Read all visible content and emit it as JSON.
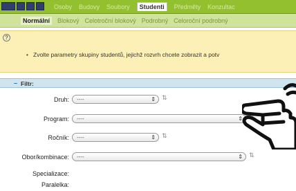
{
  "topbar": {
    "tabs": [
      "Osoby",
      "Budovy",
      "Soubory",
      "Studenti",
      "Předměty",
      "Konzultac"
    ],
    "active_tab": "Studenti"
  },
  "subbar": {
    "tabs": [
      "Normální",
      "Blokový",
      "Celotroční blokový",
      "Podrobný",
      "Celoroční podrobný"
    ],
    "active_tab": "Normální"
  },
  "info": {
    "icon": "info-icon",
    "message": "Zvolte parametry skupiny studentů, jejichž rozvrh chcete zobrazit a potv"
  },
  "filter": {
    "title": "Filtr:",
    "toggle": "–",
    "fields": [
      {
        "label": "Druh:",
        "value": "----"
      },
      {
        "label": "Program:",
        "value": "----"
      },
      {
        "label": "Ročník:",
        "value": "----"
      },
      {
        "label": "Obor/kombinace:",
        "value": "----"
      }
    ],
    "specializace_label": "Specializace:",
    "paralelka_label": "Paralelka:"
  },
  "cursor": {
    "icon": "hand-pointer-icon"
  }
}
